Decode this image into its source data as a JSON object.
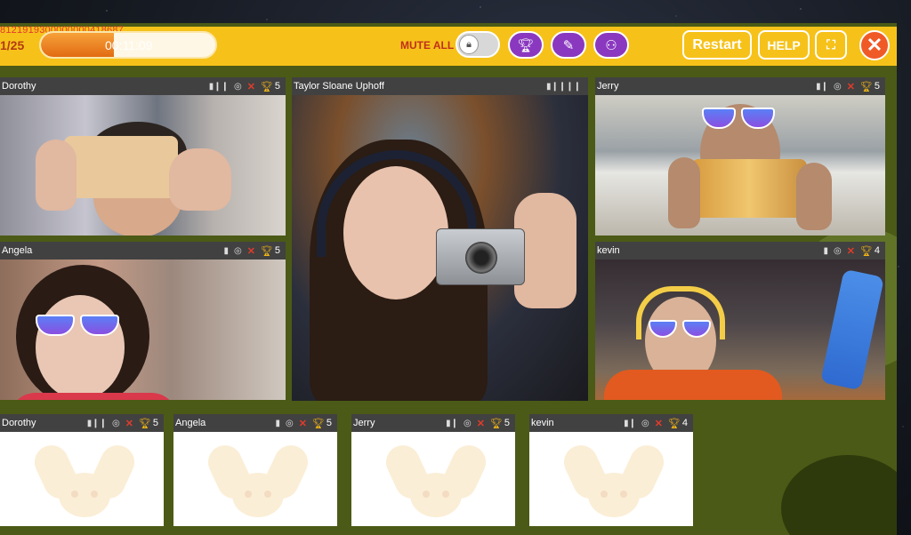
{
  "header": {
    "session_code": "8121919300000000418687",
    "page_counter": "1/25",
    "timer": "00:11:09",
    "timer_progress_percent": 42,
    "mute_all_label": "MUTE ALL",
    "restart_label": "Restart",
    "help_label": "HELP"
  },
  "icons": {
    "lock": "lock-icon",
    "trophy": "trophy-icon",
    "pen": "pen-icon",
    "group": "group-icon",
    "fullscreen": "fullscreen-icon",
    "close": "close-icon"
  },
  "colors": {
    "topbar": "#f6c21a",
    "accent_purple": "#8b38c0",
    "close_orange": "#ef5a27",
    "stage_green": "#4b5a16",
    "tile_header": "#414141"
  },
  "video_tiles": [
    {
      "name": "Dorothy",
      "score": "5"
    },
    {
      "name": "Taylor Sloane Uphoff"
    },
    {
      "name": "Jerry",
      "score": "5"
    },
    {
      "name": "Angela",
      "score": "5"
    },
    {
      "name": "kevin",
      "score": "4"
    }
  ],
  "cards": [
    {
      "name": "Dorothy",
      "score": "5"
    },
    {
      "name": "Angela",
      "score": "5"
    },
    {
      "name": "Jerry",
      "score": "5"
    },
    {
      "name": "kevin",
      "score": "4"
    }
  ]
}
